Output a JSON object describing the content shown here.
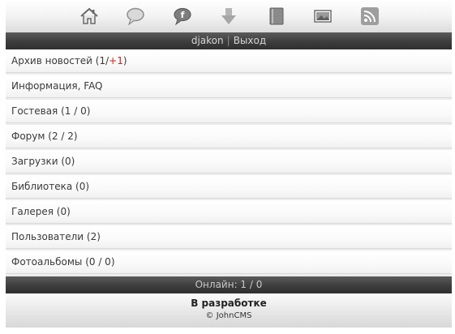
{
  "toolbar": {
    "icons": [
      {
        "name": "home-icon"
      },
      {
        "name": "chat-bubble-icon"
      },
      {
        "name": "facebook-icon"
      },
      {
        "name": "download-arrow-icon"
      },
      {
        "name": "book-icon"
      },
      {
        "name": "gallery-image-icon"
      },
      {
        "name": "rss-feed-icon"
      }
    ]
  },
  "userbar": {
    "username": "djakon",
    "separator": "|",
    "logout": "Выход"
  },
  "menu": {
    "items": [
      {
        "label": "Архив новостей",
        "count_open": " (1/",
        "count_new": "+1",
        "count_close": ")"
      },
      {
        "label": "Информация, FAQ"
      },
      {
        "label": "Гостевая",
        "count": " (1 / 0)"
      },
      {
        "label": "Форум",
        "count": " (2 / 2)"
      },
      {
        "label": "Загрузки",
        "count": " (0)"
      },
      {
        "label": "Библиотека",
        "count": " (0)"
      },
      {
        "label": "Галерея",
        "count": " (0)"
      },
      {
        "label": "Пользователи",
        "count": " (2)"
      },
      {
        "label": "Фотоальбомы",
        "count": " (0 / 0)"
      }
    ]
  },
  "online": "Онлайн: 1 / 0",
  "footer": {
    "status": "В разработке",
    "copyright": "© JohnCMS"
  },
  "colors": {
    "dark_bar": "#3d3d3d",
    "new_count": "#cc2222"
  }
}
